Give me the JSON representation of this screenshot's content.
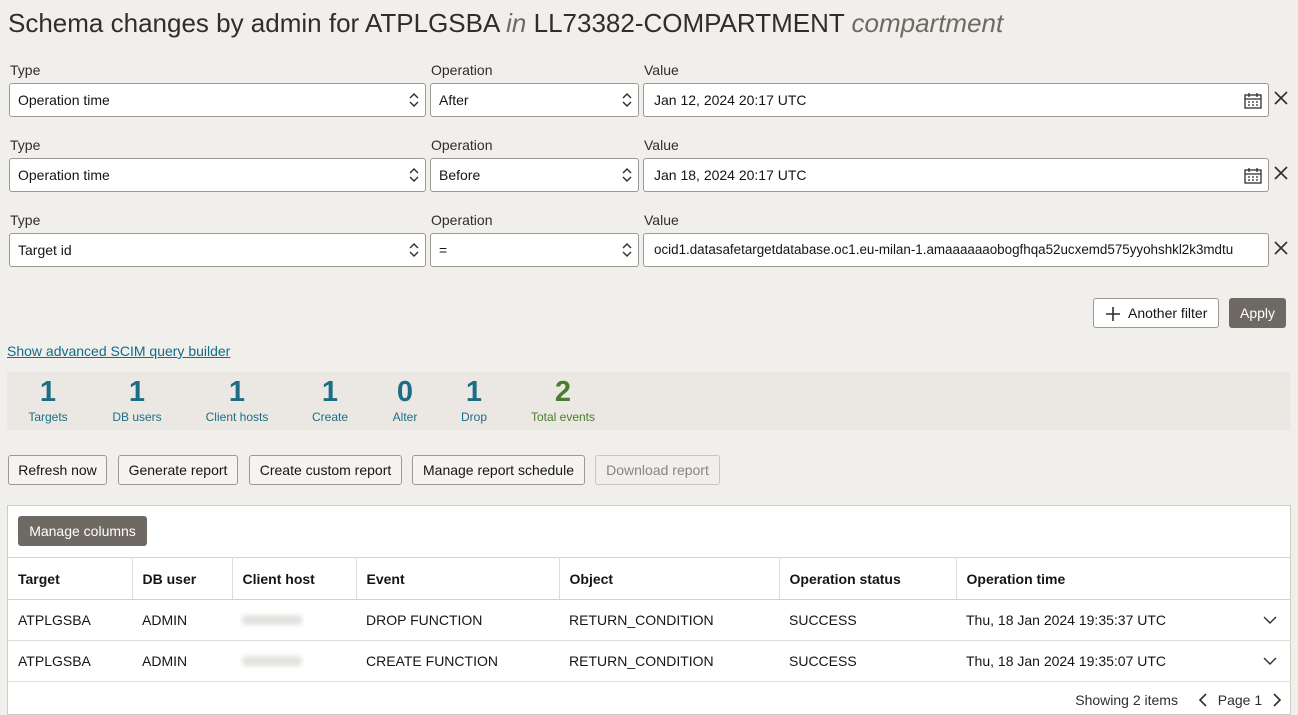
{
  "title": {
    "prefix": "Schema changes by admin for ATPLGSBA",
    "in": "in",
    "compartment_name": "LL73382-COMPARTMENT",
    "compartment_word": "compartment"
  },
  "filter_labels": {
    "type": "Type",
    "operation": "Operation",
    "value": "Value"
  },
  "filters": [
    {
      "type": "Operation time",
      "operation": "After",
      "value": "Jan 12, 2024 20:17 UTC"
    },
    {
      "type": "Operation time",
      "operation": "Before",
      "value": "Jan 18, 2024 20:17 UTC"
    },
    {
      "type": "Target id",
      "operation": "=",
      "value": "ocid1.datasafetargetdatabase.oc1.eu-milan-1.amaaaaaaobogfhqa52ucxemd575yyohshkl2k3mdtu"
    }
  ],
  "actions": {
    "another_filter": "Another filter",
    "apply": "Apply"
  },
  "advanced_link": "Show advanced SCIM query builder",
  "stats": [
    {
      "num": "1",
      "label": "Targets"
    },
    {
      "num": "1",
      "label": "DB users"
    },
    {
      "num": "1",
      "label": "Client hosts"
    },
    {
      "num": "1",
      "label": "Create"
    },
    {
      "num": "0",
      "label": "Alter"
    },
    {
      "num": "1",
      "label": "Drop"
    },
    {
      "num": "2",
      "label": "Total events"
    }
  ],
  "toolbar": {
    "refresh": "Refresh now",
    "generate": "Generate report",
    "custom": "Create custom report",
    "schedule": "Manage report schedule",
    "download": "Download report"
  },
  "table": {
    "manage_columns": "Manage columns",
    "headers": [
      "Target",
      "DB user",
      "Client host",
      "Event",
      "Object",
      "Operation status",
      "Operation time"
    ],
    "rows": [
      {
        "target": "ATPLGSBA",
        "db_user": "ADMIN",
        "event": "DROP FUNCTION",
        "object": "RETURN_CONDITION",
        "status": "SUCCESS",
        "time": "Thu, 18 Jan 2024 19:35:37 UTC"
      },
      {
        "target": "ATPLGSBA",
        "db_user": "ADMIN",
        "event": "CREATE FUNCTION",
        "object": "RETURN_CONDITION",
        "status": "SUCCESS",
        "time": "Thu, 18 Jan 2024 19:35:07 UTC"
      }
    ],
    "showing": "Showing 2 items",
    "page": "Page 1"
  },
  "colors": {
    "accent": "#1c6d86",
    "total": "#4a7d2c",
    "dark_button": "#6f6964",
    "link": "#0f6d8a"
  }
}
